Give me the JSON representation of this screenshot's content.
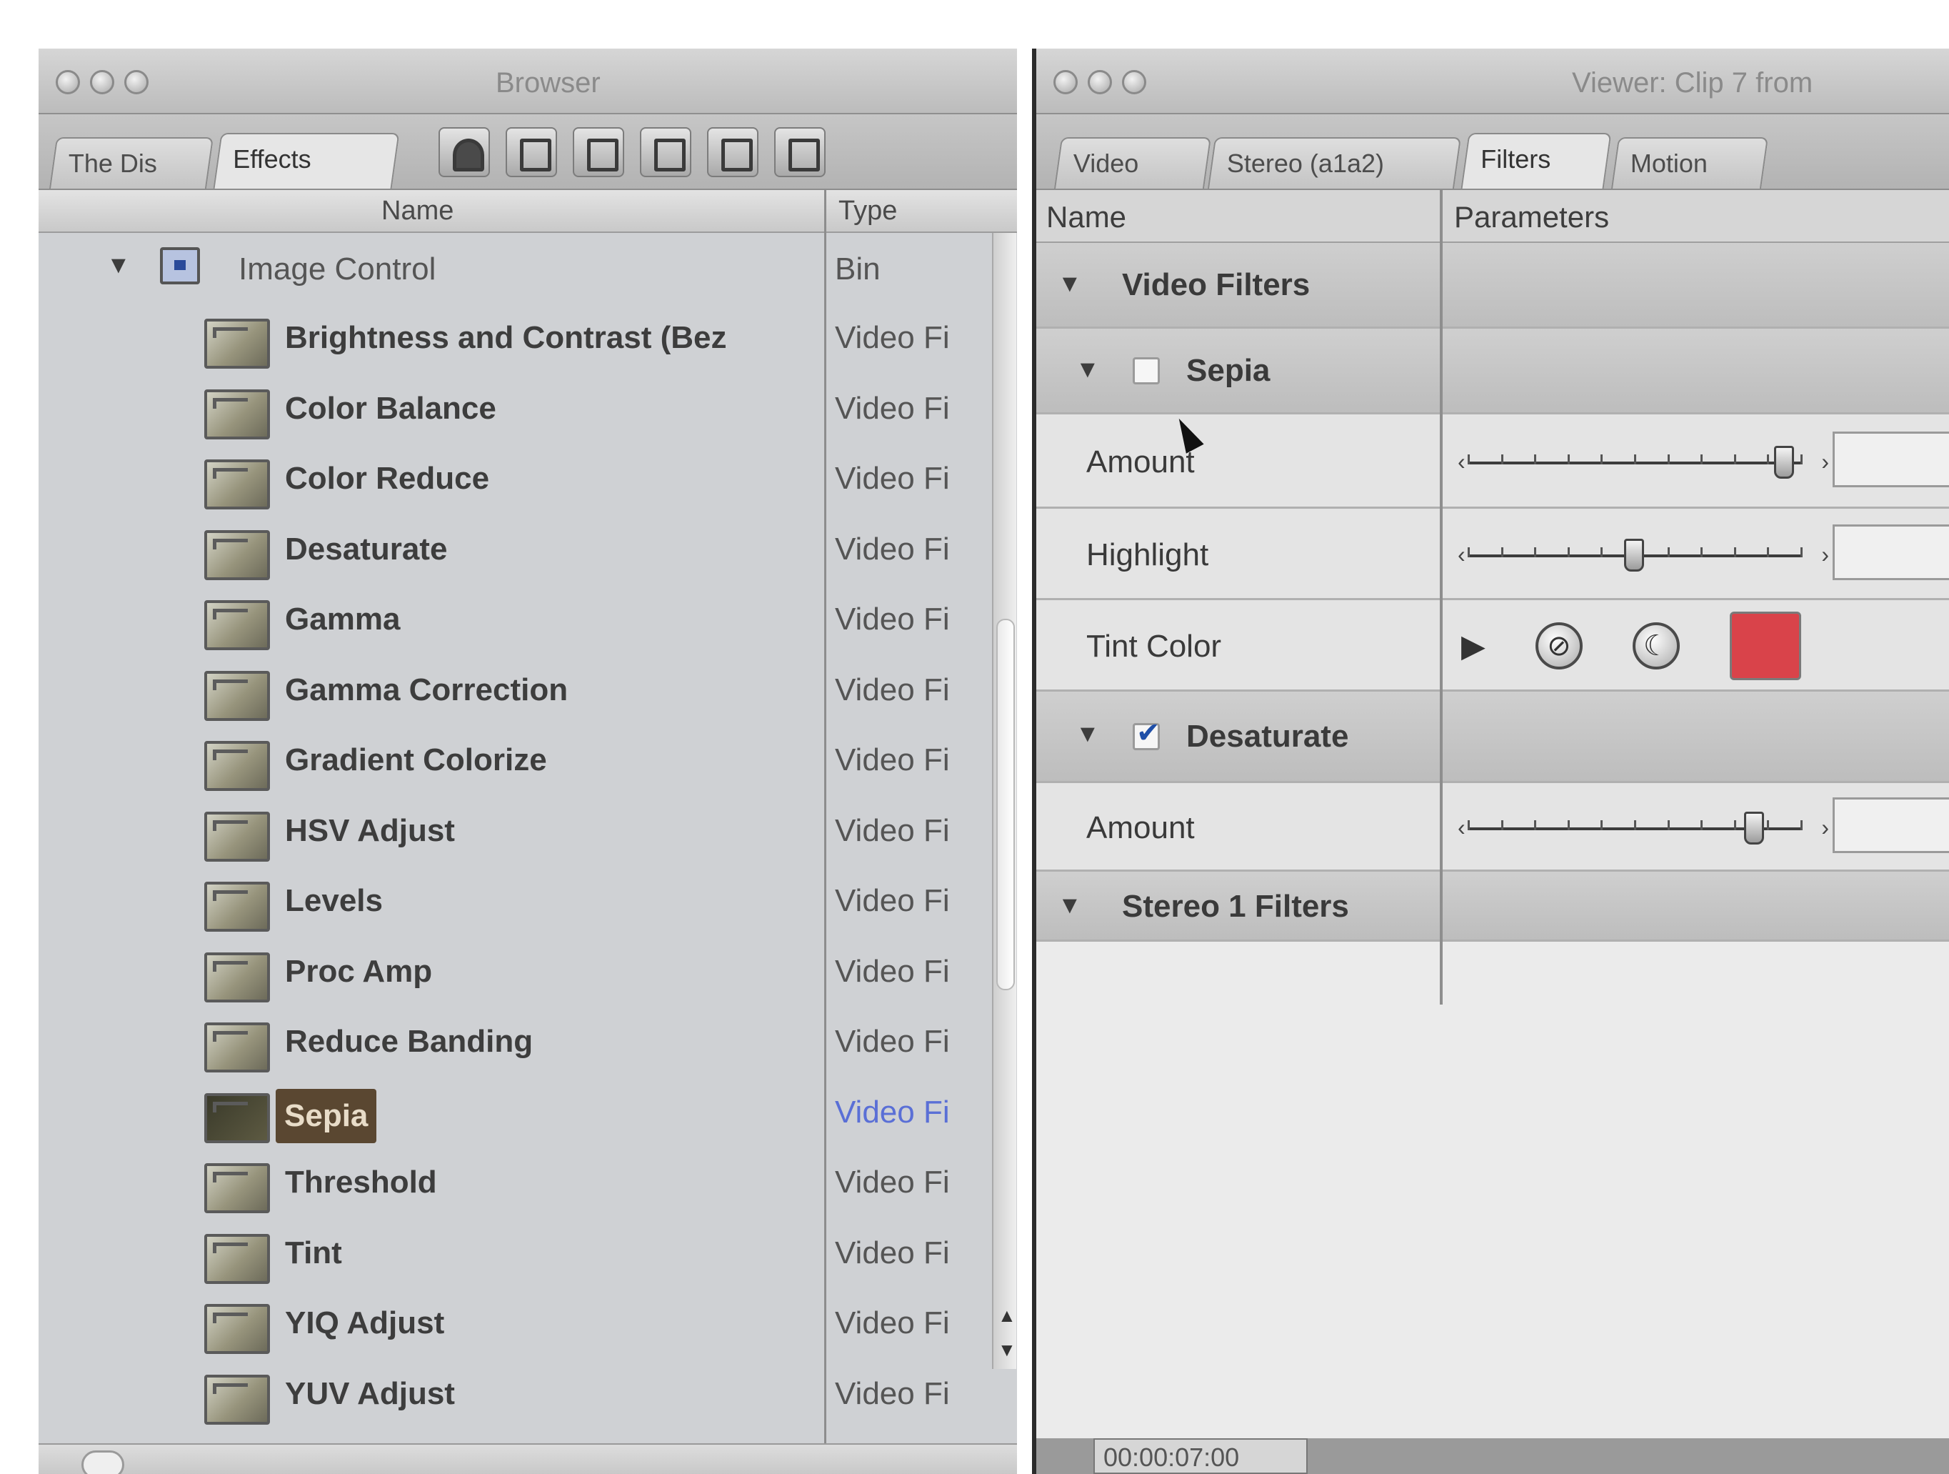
{
  "browser": {
    "title": "Browser",
    "tabs": [
      "The Dis",
      "Effects"
    ],
    "active_tab": "Effects",
    "columns": {
      "name": "Name",
      "type": "Type"
    },
    "bin": {
      "name": "Image Control",
      "type": "Bin"
    },
    "items": [
      {
        "name": "Brightness and Contrast (Bez",
        "type": "Video Fi"
      },
      {
        "name": "Color Balance",
        "type": "Video Fi"
      },
      {
        "name": "Color Reduce",
        "type": "Video Fi"
      },
      {
        "name": "Desaturate",
        "type": "Video Fi"
      },
      {
        "name": "Gamma",
        "type": "Video Fi"
      },
      {
        "name": "Gamma Correction",
        "type": "Video Fi"
      },
      {
        "name": "Gradient Colorize",
        "type": "Video Fi"
      },
      {
        "name": "HSV Adjust",
        "type": "Video Fi"
      },
      {
        "name": "Levels",
        "type": "Video Fi"
      },
      {
        "name": "Proc Amp",
        "type": "Video Fi"
      },
      {
        "name": "Reduce Banding",
        "type": "Video Fi"
      },
      {
        "name": "Sepia",
        "type": "Video Fi",
        "selected": true
      },
      {
        "name": "Threshold",
        "type": "Video Fi"
      },
      {
        "name": "Tint",
        "type": "Video Fi"
      },
      {
        "name": "YIQ Adjust",
        "type": "Video Fi"
      },
      {
        "name": "YUV Adjust",
        "type": "Video Fi"
      }
    ]
  },
  "viewer": {
    "title": "Viewer: Clip 7 from",
    "tabs": [
      "Video",
      "Stereo (a1a2)",
      "Filters",
      "Motion"
    ],
    "active_tab": "Filters",
    "columns": {
      "name": "Name",
      "parameters": "Parameters"
    },
    "video_filters_label": "Video Filters",
    "sepia": {
      "label": "Sepia",
      "enabled": false,
      "amount_label": "Amount",
      "amount_level": 0.95,
      "highlight_label": "Highlight",
      "highlight_level": 0.5,
      "tint_label": "Tint Color",
      "tint_color": "#d9434a"
    },
    "desaturate": {
      "label": "Desaturate",
      "enabled": true,
      "amount_label": "Amount",
      "amount_level": 0.86
    },
    "stereo_filters_label": "Stereo 1 Filters",
    "timecode": "00:00:07:00"
  },
  "colors": {
    "selection": "#5a4731",
    "checkbox": "#1f4fa8",
    "tint_swatch": "#d9434a"
  }
}
